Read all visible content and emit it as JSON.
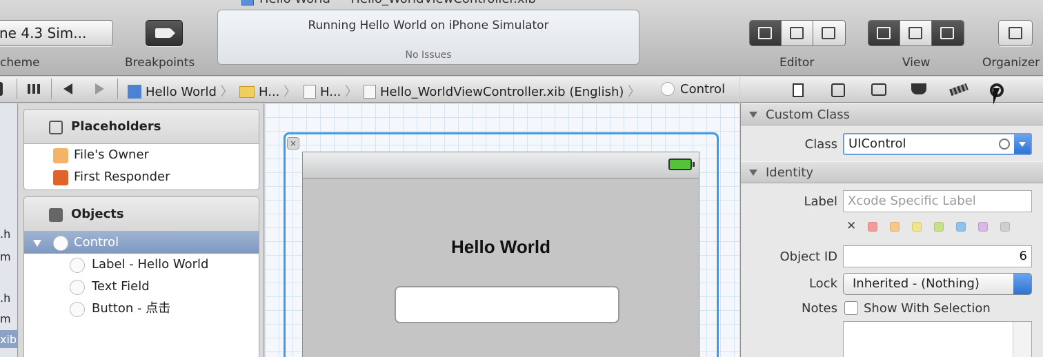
{
  "window": {
    "title": "Hello World — Hello_WorldViewController.xib"
  },
  "toolbar": {
    "scheme_value": "ne 4.3 Sim...",
    "scheme_label": "cheme",
    "breakpoints_label": "Breakpoints",
    "activity_main": "Running Hello World on iPhone Simulator",
    "activity_sub": "No Issues",
    "editor_label": "Editor",
    "view_label": "View",
    "organizer_label": "Organizer"
  },
  "jumpbar": {
    "crumbs": [
      "Hello World",
      "H...",
      "H...",
      "Hello_WorldViewController.xib (English)",
      "Control"
    ]
  },
  "navigator": {
    "fragments": [
      ".h",
      "m",
      ".h",
      "m",
      "xib"
    ]
  },
  "outline": {
    "placeholders_title": "Placeholders",
    "placeholders": [
      "File's Owner",
      "First Responder"
    ],
    "objects_title": "Objects",
    "objects": [
      "Control",
      "Label - Hello World",
      "Text Field",
      "Button - 点击"
    ]
  },
  "canvas": {
    "label_text": "Hello World"
  },
  "inspector": {
    "custom_class_title": "Custom Class",
    "class_label": "Class",
    "class_value": "UIControl",
    "identity_title": "Identity",
    "label_label": "Label",
    "label_placeholder": "Xcode Specific Label",
    "clear_label": "✕",
    "label_colors": [
      "#f39a9a",
      "#f7c788",
      "#f1e58a",
      "#c8e08a",
      "#8fc3ee",
      "#d8b8e8",
      "#cfcfcf"
    ],
    "object_id_label": "Object ID",
    "object_id_value": "6",
    "lock_label": "Lock",
    "lock_value": "Inherited - (Nothing)",
    "notes_label": "Notes",
    "show_with_selection": "Show With Selection"
  }
}
